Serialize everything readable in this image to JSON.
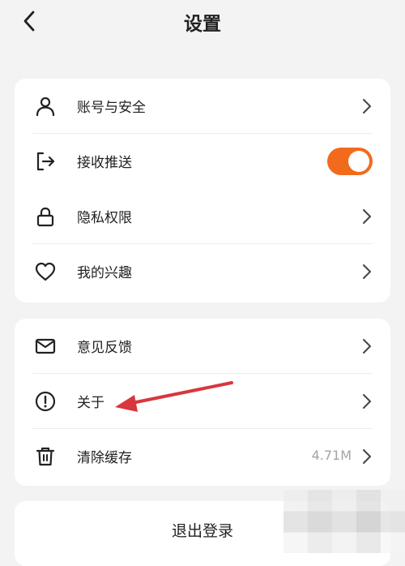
{
  "header": {
    "title": "设置"
  },
  "group1": [
    {
      "label": "账号与安全",
      "icon": "person-icon"
    },
    {
      "label": "接收推送",
      "icon": "logout-arrow-icon",
      "toggle_on": true
    },
    {
      "label": "隐私权限",
      "icon": "lock-icon"
    },
    {
      "label": "我的兴趣",
      "icon": "heart-icon"
    }
  ],
  "group2": [
    {
      "label": "意见反馈",
      "icon": "mail-icon"
    },
    {
      "label": "关于",
      "icon": "info-circle-icon"
    },
    {
      "label": "清除缓存",
      "icon": "trash-icon",
      "value": "4.71M"
    }
  ],
  "logout_label": "退出登录",
  "colors": {
    "accent": "#f26b1d",
    "annotation_arrow": "#d9363e",
    "background": "#f3f3f3"
  }
}
